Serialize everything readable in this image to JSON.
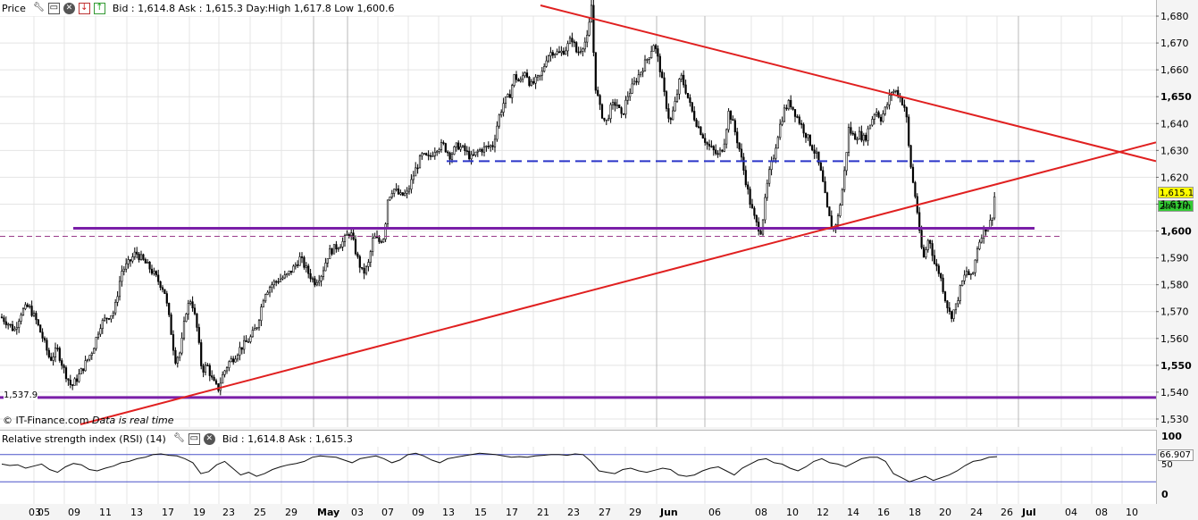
{
  "price_header": {
    "title": "Price",
    "quote": "Bid : 1,614.8 Ask : 1,615.3 Day:High 1,617.8 Low 1,600.6"
  },
  "rsi_header": {
    "title": "Relative strength index (RSI) (14)",
    "quote": "Bid : 1,614.8 Ask : 1,615.3"
  },
  "credit": {
    "source": "© IT-Finance.com",
    "note": "Data is real time"
  },
  "price_tags": {
    "last": "1,615.1",
    "countdown": "2h47m",
    "rsi_value": "66.907"
  },
  "left_marker": "1,537.9",
  "colors": {
    "candle": "#000000",
    "trendline": "#e02020",
    "support": "#7a1fa8",
    "dashed_support": "#9a3d8a",
    "dashed_resistance": "#2a35c8",
    "rsi_line": "#111111",
    "rsi_level": "#4a52c8",
    "grid": "#e4e4e4"
  },
  "chart_data": [
    {
      "type": "candlestick",
      "title": "Price",
      "y_ticks": [
        "1,530",
        "1,540",
        "1,550",
        "1,560",
        "1,570",
        "1,580",
        "1,590",
        "1,600",
        "1,610",
        "1,620",
        "1,630",
        "1,640",
        "1,650",
        "1,660",
        "1,670",
        "1,680"
      ],
      "ylim": [
        1527,
        1686
      ],
      "x_ticks": [
        "03",
        "05",
        "09",
        "11",
        "13",
        "17",
        "19",
        "23",
        "25",
        "29",
        "May",
        "03",
        "07",
        "09",
        "13",
        "15",
        "17",
        "21",
        "23",
        "27",
        "29",
        "Jun",
        "06",
        "08",
        "10",
        "12",
        "14",
        "16",
        "18",
        "20",
        "24",
        "26",
        "Jul",
        "04",
        "08",
        "10"
      ],
      "x_tick_bold": [
        "May",
        "Jun",
        "Jul"
      ],
      "grid": true,
      "close_path": [
        [
          1,
          1568
        ],
        [
          8,
          1566
        ],
        [
          16,
          1563
        ],
        [
          24,
          1570
        ],
        [
          32,
          1572
        ],
        [
          40,
          1567
        ],
        [
          48,
          1560
        ],
        [
          56,
          1552
        ],
        [
          64,
          1556
        ],
        [
          72,
          1548
        ],
        [
          80,
          1542
        ],
        [
          88,
          1546
        ],
        [
          96,
          1551
        ],
        [
          104,
          1556
        ],
        [
          112,
          1565
        ],
        [
          120,
          1568
        ],
        [
          128,
          1570
        ],
        [
          136,
          1585
        ],
        [
          144,
          1588
        ],
        [
          152,
          1592
        ],
        [
          160,
          1589
        ],
        [
          168,
          1586
        ],
        [
          176,
          1582
        ],
        [
          184,
          1578
        ],
        [
          190,
          1566
        ],
        [
          196,
          1552
        ],
        [
          202,
          1555
        ],
        [
          208,
          1570
        ],
        [
          214,
          1575
        ],
        [
          220,
          1565
        ],
        [
          226,
          1548
        ],
        [
          232,
          1550
        ],
        [
          238,
          1544
        ],
        [
          244,
          1541
        ],
        [
          250,
          1547
        ],
        [
          256,
          1551
        ],
        [
          262,
          1553
        ],
        [
          268,
          1556
        ],
        [
          274,
          1558
        ],
        [
          280,
          1560
        ],
        [
          288,
          1565
        ],
        [
          296,
          1577
        ],
        [
          304,
          1580
        ],
        [
          312,
          1582
        ],
        [
          320,
          1583
        ],
        [
          328,
          1586
        ],
        [
          336,
          1590
        ],
        [
          344,
          1585
        ],
        [
          352,
          1581
        ],
        [
          360,
          1584
        ],
        [
          368,
          1592
        ],
        [
          376,
          1594
        ],
        [
          384,
          1596
        ],
        [
          392,
          1600
        ],
        [
          400,
          1590
        ],
        [
          406,
          1584
        ],
        [
          412,
          1587
        ],
        [
          418,
          1598
        ],
        [
          424,
          1596
        ],
        [
          430,
          1598
        ],
        [
          434,
          1612
        ],
        [
          440,
          1616
        ],
        [
          448,
          1613
        ],
        [
          456,
          1614
        ],
        [
          464,
          1622
        ],
        [
          472,
          1628
        ],
        [
          480,
          1627
        ],
        [
          488,
          1631
        ],
        [
          496,
          1632
        ],
        [
          504,
          1628
        ],
        [
          512,
          1632
        ],
        [
          520,
          1630
        ],
        [
          528,
          1627
        ],
        [
          536,
          1630
        ],
        [
          544,
          1631
        ],
        [
          552,
          1632
        ],
        [
          558,
          1642
        ],
        [
          564,
          1648
        ],
        [
          570,
          1650
        ],
        [
          576,
          1658
        ],
        [
          582,
          1655
        ],
        [
          588,
          1660
        ],
        [
          594,
          1654
        ],
        [
          600,
          1656
        ],
        [
          606,
          1658
        ],
        [
          612,
          1665
        ],
        [
          618,
          1667
        ],
        [
          626,
          1666
        ],
        [
          634,
          1668
        ],
        [
          640,
          1672
        ],
        [
          646,
          1666
        ],
        [
          652,
          1669
        ],
        [
          658,
          1672
        ],
        [
          662,
          1684
        ],
        [
          666,
          1655
        ],
        [
          672,
          1645
        ],
        [
          678,
          1640
        ],
        [
          684,
          1646
        ],
        [
          690,
          1648
        ],
        [
          696,
          1642
        ],
        [
          702,
          1650
        ],
        [
          710,
          1655
        ],
        [
          718,
          1660
        ],
        [
          726,
          1665
        ],
        [
          732,
          1670
        ],
        [
          738,
          1662
        ],
        [
          744,
          1650
        ],
        [
          750,
          1640
        ],
        [
          756,
          1648
        ],
        [
          762,
          1658
        ],
        [
          768,
          1652
        ],
        [
          774,
          1645
        ],
        [
          780,
          1640
        ],
        [
          786,
          1636
        ],
        [
          792,
          1632
        ],
        [
          798,
          1630
        ],
        [
          804,
          1628
        ],
        [
          810,
          1632
        ],
        [
          816,
          1645
        ],
        [
          822,
          1638
        ],
        [
          828,
          1630
        ],
        [
          834,
          1620
        ],
        [
          840,
          1610
        ],
        [
          846,
          1603
        ],
        [
          852,
          1600
        ],
        [
          856,
          1610
        ],
        [
          860,
          1620
        ],
        [
          866,
          1628
        ],
        [
          872,
          1638
        ],
        [
          878,
          1645
        ],
        [
          884,
          1648
        ],
        [
          890,
          1644
        ],
        [
          896,
          1640
        ],
        [
          902,
          1636
        ],
        [
          908,
          1632
        ],
        [
          914,
          1628
        ],
        [
          920,
          1620
        ],
        [
          926,
          1608
        ],
        [
          932,
          1600
        ],
        [
          938,
          1605
        ],
        [
          944,
          1618
        ],
        [
          950,
          1638
        ],
        [
          956,
          1635
        ],
        [
          962,
          1636
        ],
        [
          968,
          1634
        ],
        [
          974,
          1640
        ],
        [
          980,
          1645
        ],
        [
          986,
          1642
        ],
        [
          992,
          1646
        ],
        [
          998,
          1652
        ],
        [
          1004,
          1652
        ],
        [
          1010,
          1648
        ],
        [
          1014,
          1645
        ],
        [
          1018,
          1628
        ],
        [
          1022,
          1618
        ],
        [
          1026,
          1610
        ],
        [
          1030,
          1596
        ],
        [
          1034,
          1590
        ],
        [
          1040,
          1598
        ],
        [
          1046,
          1588
        ],
        [
          1052,
          1584
        ],
        [
          1058,
          1575
        ],
        [
          1064,
          1568
        ],
        [
          1070,
          1572
        ],
        [
          1076,
          1580
        ],
        [
          1082,
          1585
        ],
        [
          1088,
          1582
        ],
        [
          1094,
          1594
        ],
        [
          1100,
          1600
        ],
        [
          1106,
          1602
        ],
        [
          1110,
          1604
        ],
        [
          1114,
          1615
        ]
      ],
      "annotations": {
        "support_solid": [
          1601,
          1538
        ],
        "resistance_dashed": 1626,
        "support_dashed": 1598,
        "triangle_upper": {
          "from": [
            605,
            1684
          ],
          "to": [
            1294,
            1626
          ]
        },
        "triangle_lower": {
          "from": [
            90,
            1528
          ],
          "to": [
            1294,
            1633
          ]
        }
      }
    },
    {
      "type": "line",
      "title": "Relative strength index (RSI) (14)",
      "y_ticks": [
        "100",
        "50",
        "0"
      ],
      "ylim": [
        0,
        100
      ],
      "levels": [
        70,
        30
      ],
      "values": [
        56,
        54,
        55,
        50,
        53,
        56,
        48,
        44,
        52,
        57,
        55,
        48,
        46,
        50,
        53,
        58,
        60,
        64,
        66,
        70,
        71,
        69,
        68,
        64,
        58,
        42,
        45,
        55,
        60,
        50,
        40,
        44,
        38,
        42,
        48,
        52,
        55,
        57,
        60,
        66,
        68,
        67,
        66,
        62,
        58,
        64,
        66,
        68,
        64,
        58,
        62,
        70,
        72,
        68,
        62,
        58,
        64,
        66,
        68,
        70,
        72,
        71,
        70,
        68,
        66,
        67,
        66,
        68,
        69,
        70,
        70,
        69,
        71,
        70,
        60,
        46,
        44,
        42,
        48,
        50,
        46,
        44,
        47,
        50,
        48,
        40,
        38,
        40,
        46,
        50,
        52,
        46,
        40,
        50,
        56,
        62,
        64,
        58,
        56,
        50,
        46,
        52,
        60,
        64,
        58,
        56,
        52,
        58,
        64,
        66,
        66,
        60,
        42,
        36,
        30,
        34,
        38,
        32,
        36,
        40,
        46,
        54,
        60,
        62,
        66,
        67
      ]
    }
  ]
}
